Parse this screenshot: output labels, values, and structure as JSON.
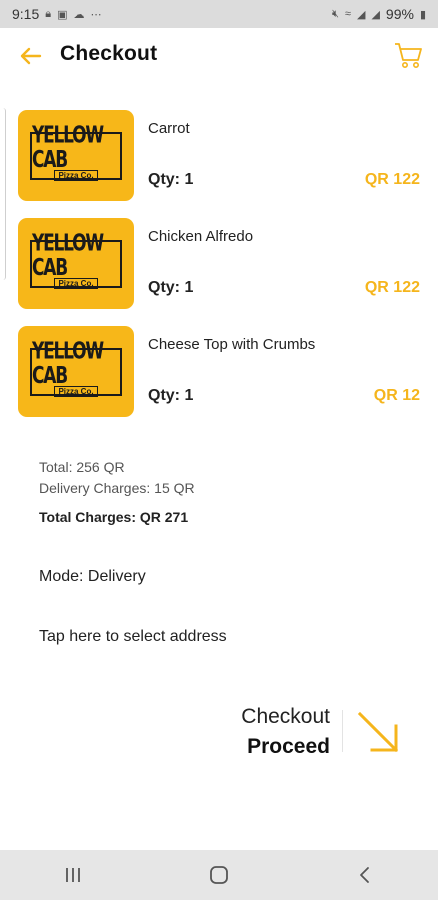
{
  "status_bar": {
    "time": "9:15",
    "battery": "99%",
    "icons_left": [
      "lock-icon",
      "image-icon",
      "cloud-icon",
      "more-icon"
    ],
    "icons_right": [
      "mute-icon",
      "nfc-icon",
      "wifi-icon",
      "signal-icon",
      "signal-icon",
      "battery-icon"
    ]
  },
  "header": {
    "title": "Checkout",
    "back_icon": "back-arrow-icon",
    "cart_icon": "cart-icon"
  },
  "brand": {
    "logo_main": "YELLOW CAB",
    "logo_sub": "Pizza Co."
  },
  "items": [
    {
      "name": "Carrot",
      "qty": "Qty: 1",
      "price": "QR 122"
    },
    {
      "name": "Chicken Alfredo",
      "qty": "Qty: 1",
      "price": "QR 122"
    },
    {
      "name": "Cheese Top with Crumbs",
      "qty": "Qty: 1",
      "price": "QR 12"
    }
  ],
  "summary": {
    "total": "Total: 256 QR",
    "delivery": "Delivery Charges: 15 QR",
    "total_charges": "Total Charges: QR 271"
  },
  "mode": "Mode: Delivery",
  "address_prompt": "Tap here to select address",
  "checkout": {
    "label": "Checkout",
    "action": "Proceed"
  },
  "colors": {
    "accent": "#f5b51c",
    "logo_bg": "#f7b719"
  }
}
